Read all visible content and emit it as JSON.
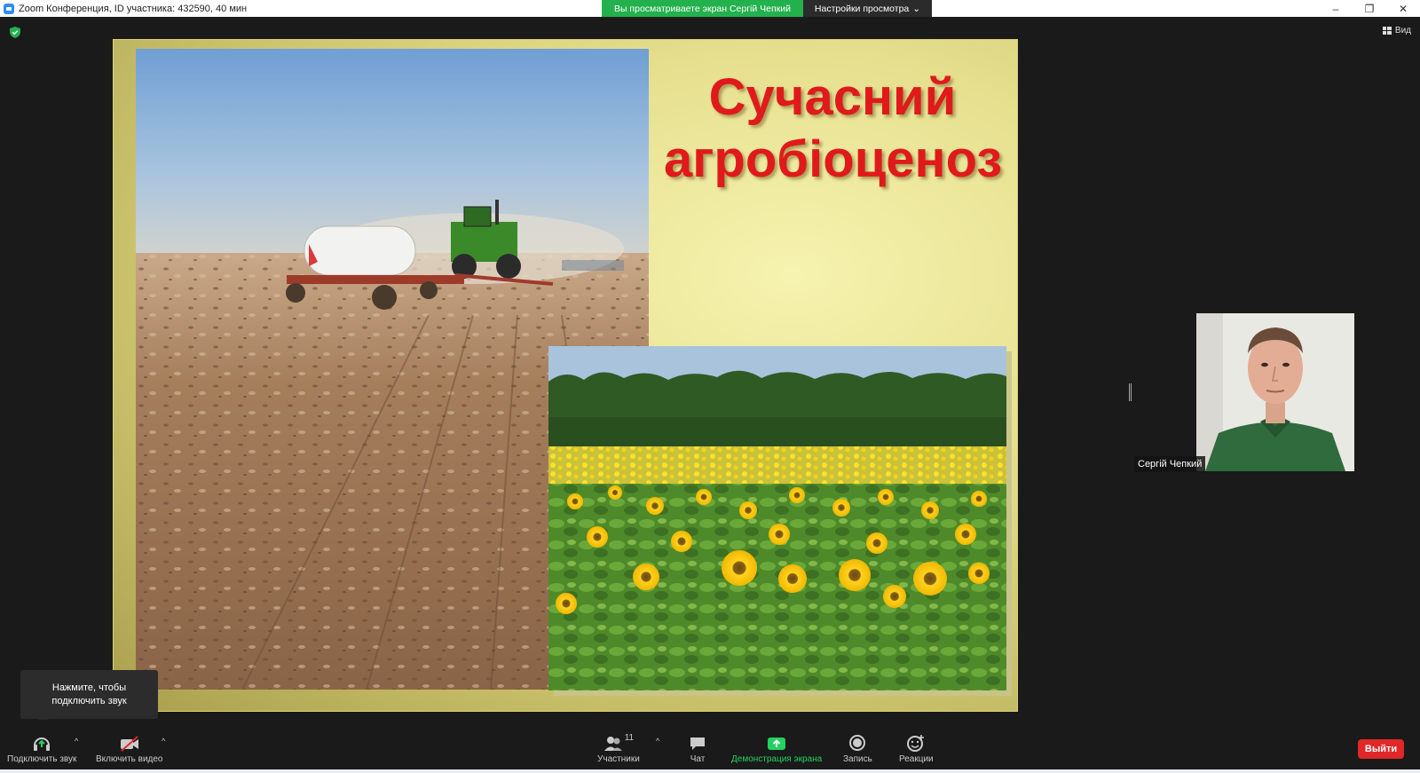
{
  "window": {
    "title": "Zoom Конференция, ID участника: 432590, 40 мин",
    "viewing_banner": "Вы просматриваете экран Сергій Чепкий",
    "view_settings_label": "Настройки просмотра",
    "minimize": "–",
    "restore": "❐",
    "close": "✕"
  },
  "stage": {
    "view_label": "Вид"
  },
  "slide": {
    "title_line1": "Сучасний",
    "title_line2": "агробіоценоз"
  },
  "participant": {
    "name": "Сергій Чепкий"
  },
  "tooltip": {
    "line1": "Нажмите, чтобы",
    "line2": "подключить звук"
  },
  "toolbar": {
    "join_audio": "Подключить звук",
    "start_video": "Включить видео",
    "participants": "Участники",
    "participants_count": "11",
    "chat": "Чат",
    "share_screen": "Демонстрация экрана",
    "record": "Запись",
    "reactions": "Реакции",
    "leave": "Выйти"
  },
  "colors": {
    "share_green": "#23b14d",
    "leave_red": "#e02828",
    "slide_title_red": "#e01a1a"
  }
}
